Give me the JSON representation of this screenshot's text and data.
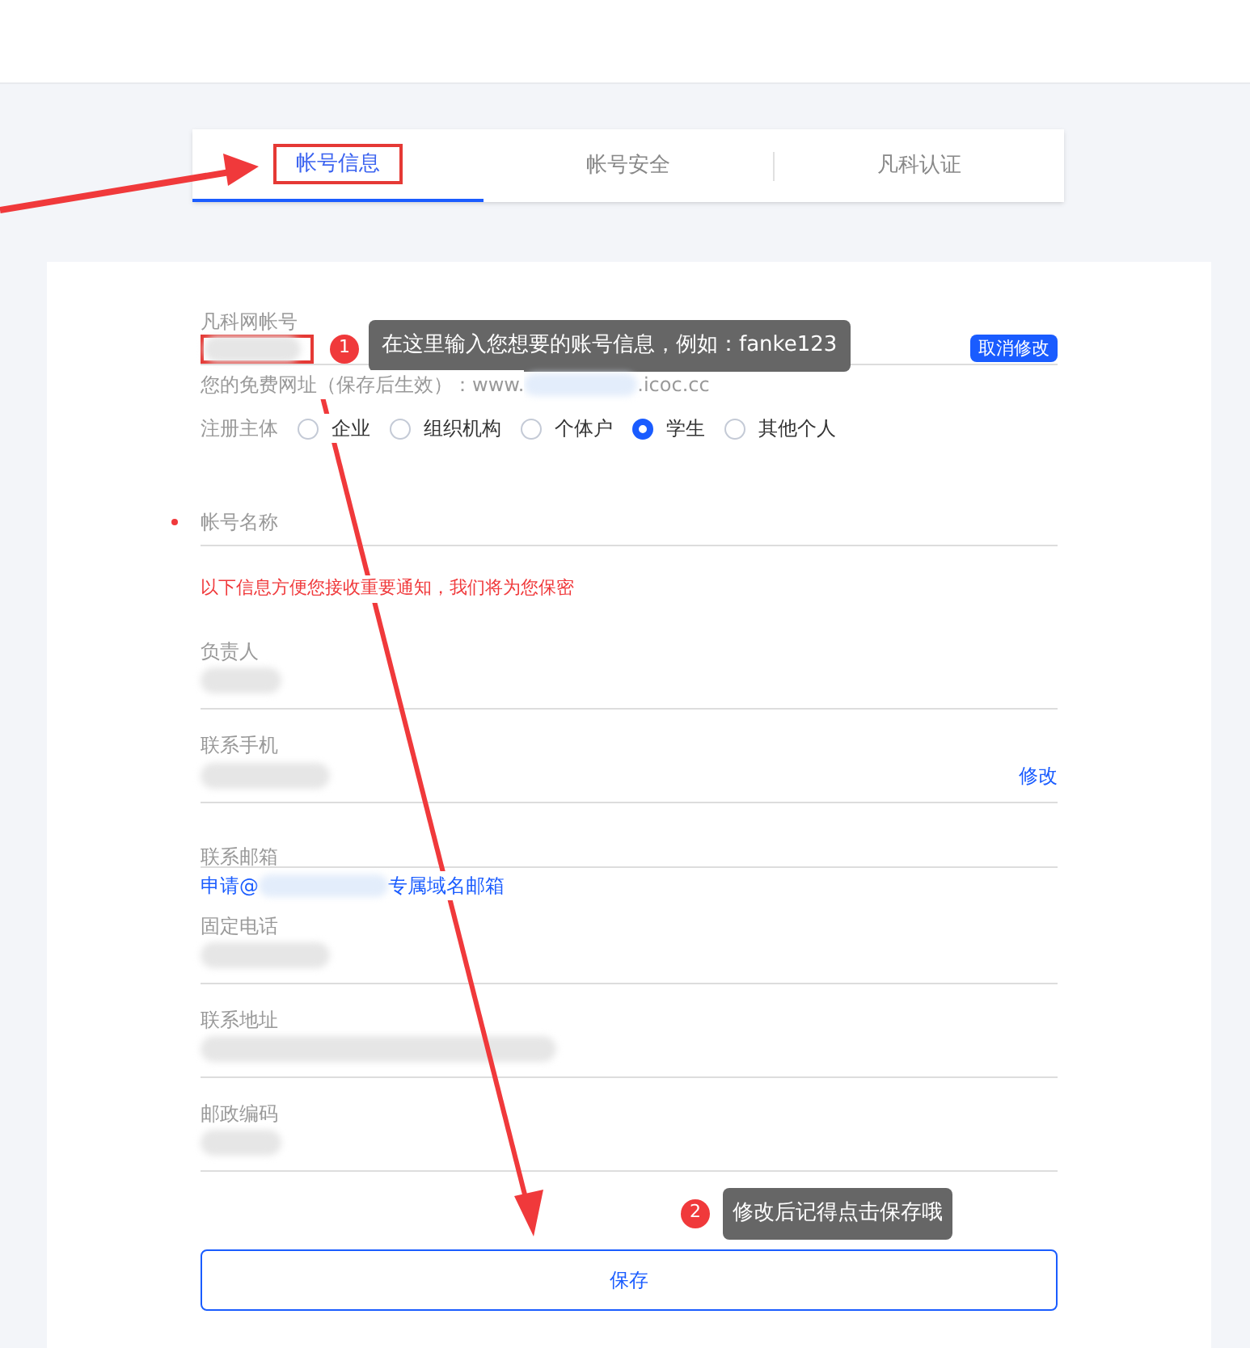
{
  "tabs": [
    {
      "label": "帐号信息",
      "selected": true
    },
    {
      "label": "帐号安全",
      "selected": false
    },
    {
      "label": "凡科认证",
      "selected": false
    }
  ],
  "account": {
    "label": "凡科网帐号",
    "cancel_button": "取消修改",
    "tip_number": "1",
    "tip": "在这里输入您想要的账号信息，例如：fanke123",
    "url_prefix": "您的免费网址（保存后生效）：www.",
    "url_suffix": ".icoc.cc"
  },
  "subject": {
    "label": "注册主体",
    "options": [
      {
        "label": "企业",
        "selected": false
      },
      {
        "label": "组织机构",
        "selected": false
      },
      {
        "label": "个体户",
        "selected": false
      },
      {
        "label": "学生",
        "selected": true
      },
      {
        "label": "其他个人",
        "selected": false
      }
    ]
  },
  "name_field": {
    "label": "帐号名称",
    "required": true
  },
  "notice": "以下信息方便您接收重要通知，我们将为您保密",
  "fields": [
    {
      "kind": "text",
      "label": "负责人"
    },
    {
      "kind": "text",
      "label": "联系手机",
      "action": "修改"
    },
    {
      "kind": "email",
      "label": "联系邮箱",
      "link_prefix": "申请@",
      "link_suffix": "专属域名邮箱"
    },
    {
      "kind": "text",
      "label": "固定电话"
    },
    {
      "kind": "text",
      "label": "联系地址"
    },
    {
      "kind": "text",
      "label": "邮政编码"
    }
  ],
  "save_tip": {
    "number": "2",
    "text": "修改后记得点击保存哦"
  },
  "save_button": "保存"
}
